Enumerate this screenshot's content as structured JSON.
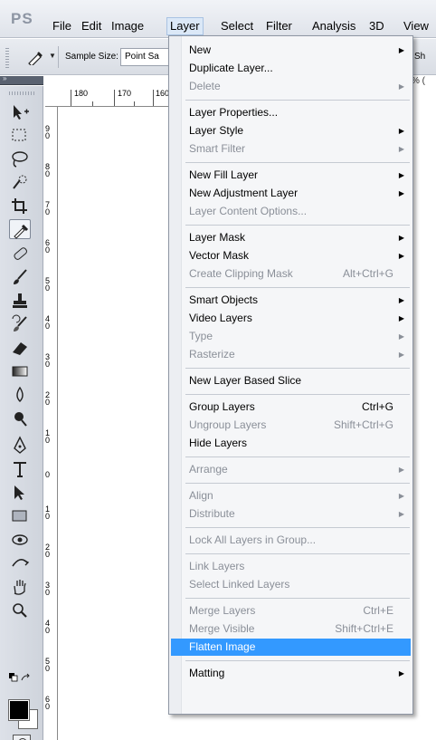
{
  "app": {
    "logo": "PS"
  },
  "menubar": {
    "items": [
      {
        "label": "File"
      },
      {
        "label": "Edit"
      },
      {
        "label": "Image"
      },
      {
        "label": "Layer"
      },
      {
        "label": "Select"
      },
      {
        "label": "Filter"
      },
      {
        "label": "Analysis"
      },
      {
        "label": "3D"
      },
      {
        "label": "View"
      }
    ]
  },
  "options_bar": {
    "sample_size_label": "Sample Size:",
    "sample_size_value": "Point Sa",
    "right_text": "Sh"
  },
  "panel_strip": {
    "arrows": "»"
  },
  "doc_tab_right": "% (",
  "ruler": {
    "h_labels": [
      "180",
      "170",
      "160"
    ],
    "v_labels": [
      "9\n0",
      "8\n0",
      "7\n0",
      "6\n0",
      "5\n0",
      "4\n0",
      "3\n0",
      "2\n0",
      "1\n0",
      "0",
      "1\n0",
      "2\n0",
      "3\n0",
      "4\n0",
      "5\n0",
      "6\n0"
    ]
  },
  "layer_menu": {
    "groups": [
      [
        {
          "label": "New",
          "submenu": true,
          "disabled": false
        },
        {
          "label": "Duplicate Layer...",
          "disabled": false
        },
        {
          "label": "Delete",
          "submenu": true,
          "disabled": true
        }
      ],
      [
        {
          "label": "Layer Properties...",
          "disabled": false
        },
        {
          "label": "Layer Style",
          "submenu": true,
          "disabled": false
        },
        {
          "label": "Smart Filter",
          "submenu": true,
          "disabled": true
        }
      ],
      [
        {
          "label": "New Fill Layer",
          "submenu": true,
          "disabled": false
        },
        {
          "label": "New Adjustment Layer",
          "submenu": true,
          "disabled": false
        },
        {
          "label": "Layer Content Options...",
          "disabled": true
        }
      ],
      [
        {
          "label": "Layer Mask",
          "submenu": true,
          "disabled": false
        },
        {
          "label": "Vector Mask",
          "submenu": true,
          "disabled": false
        },
        {
          "label": "Create Clipping Mask",
          "shortcut": "Alt+Ctrl+G",
          "disabled": true
        }
      ],
      [
        {
          "label": "Smart Objects",
          "submenu": true,
          "disabled": false
        },
        {
          "label": "Video Layers",
          "submenu": true,
          "disabled": false
        },
        {
          "label": "Type",
          "submenu": true,
          "disabled": true
        },
        {
          "label": "Rasterize",
          "submenu": true,
          "disabled": true
        }
      ],
      [
        {
          "label": "New Layer Based Slice",
          "disabled": false
        }
      ],
      [
        {
          "label": "Group Layers",
          "shortcut": "Ctrl+G",
          "disabled": false
        },
        {
          "label": "Ungroup Layers",
          "shortcut": "Shift+Ctrl+G",
          "disabled": true
        },
        {
          "label": "Hide Layers",
          "disabled": false
        }
      ],
      [
        {
          "label": "Arrange",
          "submenu": true,
          "disabled": true
        }
      ],
      [
        {
          "label": "Align",
          "submenu": true,
          "disabled": true
        },
        {
          "label": "Distribute",
          "submenu": true,
          "disabled": true
        }
      ],
      [
        {
          "label": "Lock All Layers in Group...",
          "disabled": true
        }
      ],
      [
        {
          "label": "Link Layers",
          "disabled": true
        },
        {
          "label": "Select Linked Layers",
          "disabled": true
        }
      ],
      [
        {
          "label": "Merge Layers",
          "shortcut": "Ctrl+E",
          "disabled": true
        },
        {
          "label": "Merge Visible",
          "shortcut": "Shift+Ctrl+E",
          "disabled": true
        },
        {
          "label": "Flatten Image",
          "disabled": false,
          "highlighted": true
        }
      ],
      [
        {
          "label": "Matting",
          "submenu": true,
          "disabled": false
        }
      ]
    ]
  },
  "colors": {
    "highlight": "#3399ff",
    "disabled_text": "#8a8f98",
    "menu_bg": "#f5f6f8"
  }
}
